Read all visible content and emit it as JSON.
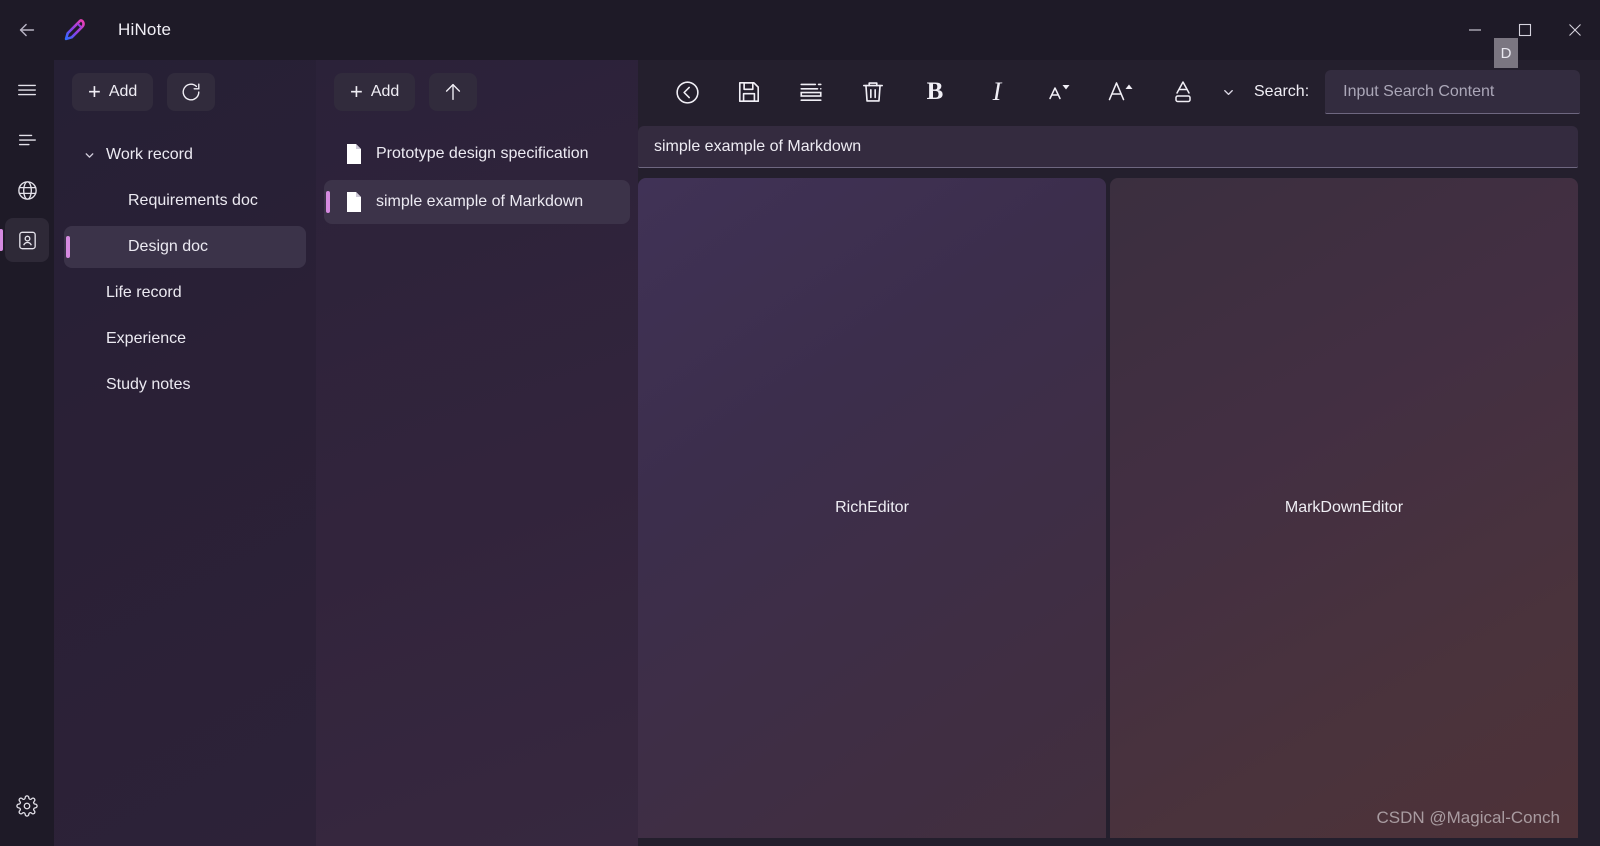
{
  "window": {
    "app_title": "HiNote",
    "back_icon": "arrow-left-icon",
    "logo_icon": "hinote-pen-logo",
    "controls": {
      "minimize": "minimize-icon",
      "maximize": "maximize-icon",
      "close": "close-icon"
    }
  },
  "rail": {
    "items": [
      {
        "icon": "hamburger-menu-icon",
        "name": "menu",
        "active": false
      },
      {
        "icon": "list-align-icon",
        "name": "outline",
        "active": false
      },
      {
        "icon": "globe-icon",
        "name": "web",
        "active": false
      },
      {
        "icon": "contact-card-icon",
        "name": "profile",
        "active": true
      }
    ],
    "bottom": {
      "icon": "gear-icon",
      "name": "settings"
    }
  },
  "tree_panel": {
    "toolbar": {
      "add_label": "Add",
      "add_icon": "plus-icon",
      "refresh_icon": "refresh-icon"
    },
    "items": [
      {
        "label": "Work record",
        "level": "root",
        "expanded": true,
        "selected": false,
        "chevron": "chevron-down-icon"
      },
      {
        "label": "Requirements doc",
        "level": "child",
        "expanded": false,
        "selected": false,
        "chevron": ""
      },
      {
        "label": "Design doc",
        "level": "child",
        "expanded": false,
        "selected": true,
        "chevron": ""
      },
      {
        "label": "Life record",
        "level": "top",
        "expanded": false,
        "selected": false,
        "chevron": ""
      },
      {
        "label": "Experience",
        "level": "top",
        "expanded": false,
        "selected": false,
        "chevron": ""
      },
      {
        "label": "Study notes",
        "level": "top",
        "expanded": false,
        "selected": false,
        "chevron": ""
      }
    ]
  },
  "notes_panel": {
    "toolbar": {
      "add_label": "Add",
      "add_icon": "plus-icon",
      "upload_icon": "arrow-up-icon"
    },
    "items": [
      {
        "label": "Prototype design specification",
        "icon": "document-icon",
        "selected": false
      },
      {
        "label": "simple example of Markdown",
        "icon": "document-icon",
        "selected": true
      }
    ]
  },
  "editor": {
    "toolbar": {
      "buttons": [
        {
          "name": "back-circle-icon",
          "label": ""
        },
        {
          "name": "save-floppy-icon",
          "label": ""
        },
        {
          "name": "layout-list-icon",
          "label": ""
        },
        {
          "name": "trash-icon",
          "label": ""
        },
        {
          "name": "bold-icon",
          "label": "B"
        },
        {
          "name": "italic-icon",
          "label": "I"
        },
        {
          "name": "font-size-decrease-icon",
          "label": "A"
        },
        {
          "name": "font-size-increase-icon",
          "label": "A"
        },
        {
          "name": "text-color-icon",
          "label": "A"
        }
      ],
      "color_chevron_icon": "chevron-down-icon",
      "tooltip_badge": "D",
      "search_label": "Search:",
      "search_placeholder": "Input Search Content",
      "search_value": ""
    },
    "title_value": "simple example of Markdown",
    "title_placeholder": "",
    "panes": [
      {
        "name": "rich-editor",
        "label": "RichEditor"
      },
      {
        "name": "markdown-editor",
        "label": "MarkDownEditor"
      }
    ]
  },
  "watermark": "CSDN @Magical-Conch",
  "colors": {
    "accent": "#d58ae0",
    "window_bg": "#1e1a27",
    "panel_bg": "#2b2239",
    "button_bg": "#312b3c",
    "selected_bg": "#3b3349"
  }
}
